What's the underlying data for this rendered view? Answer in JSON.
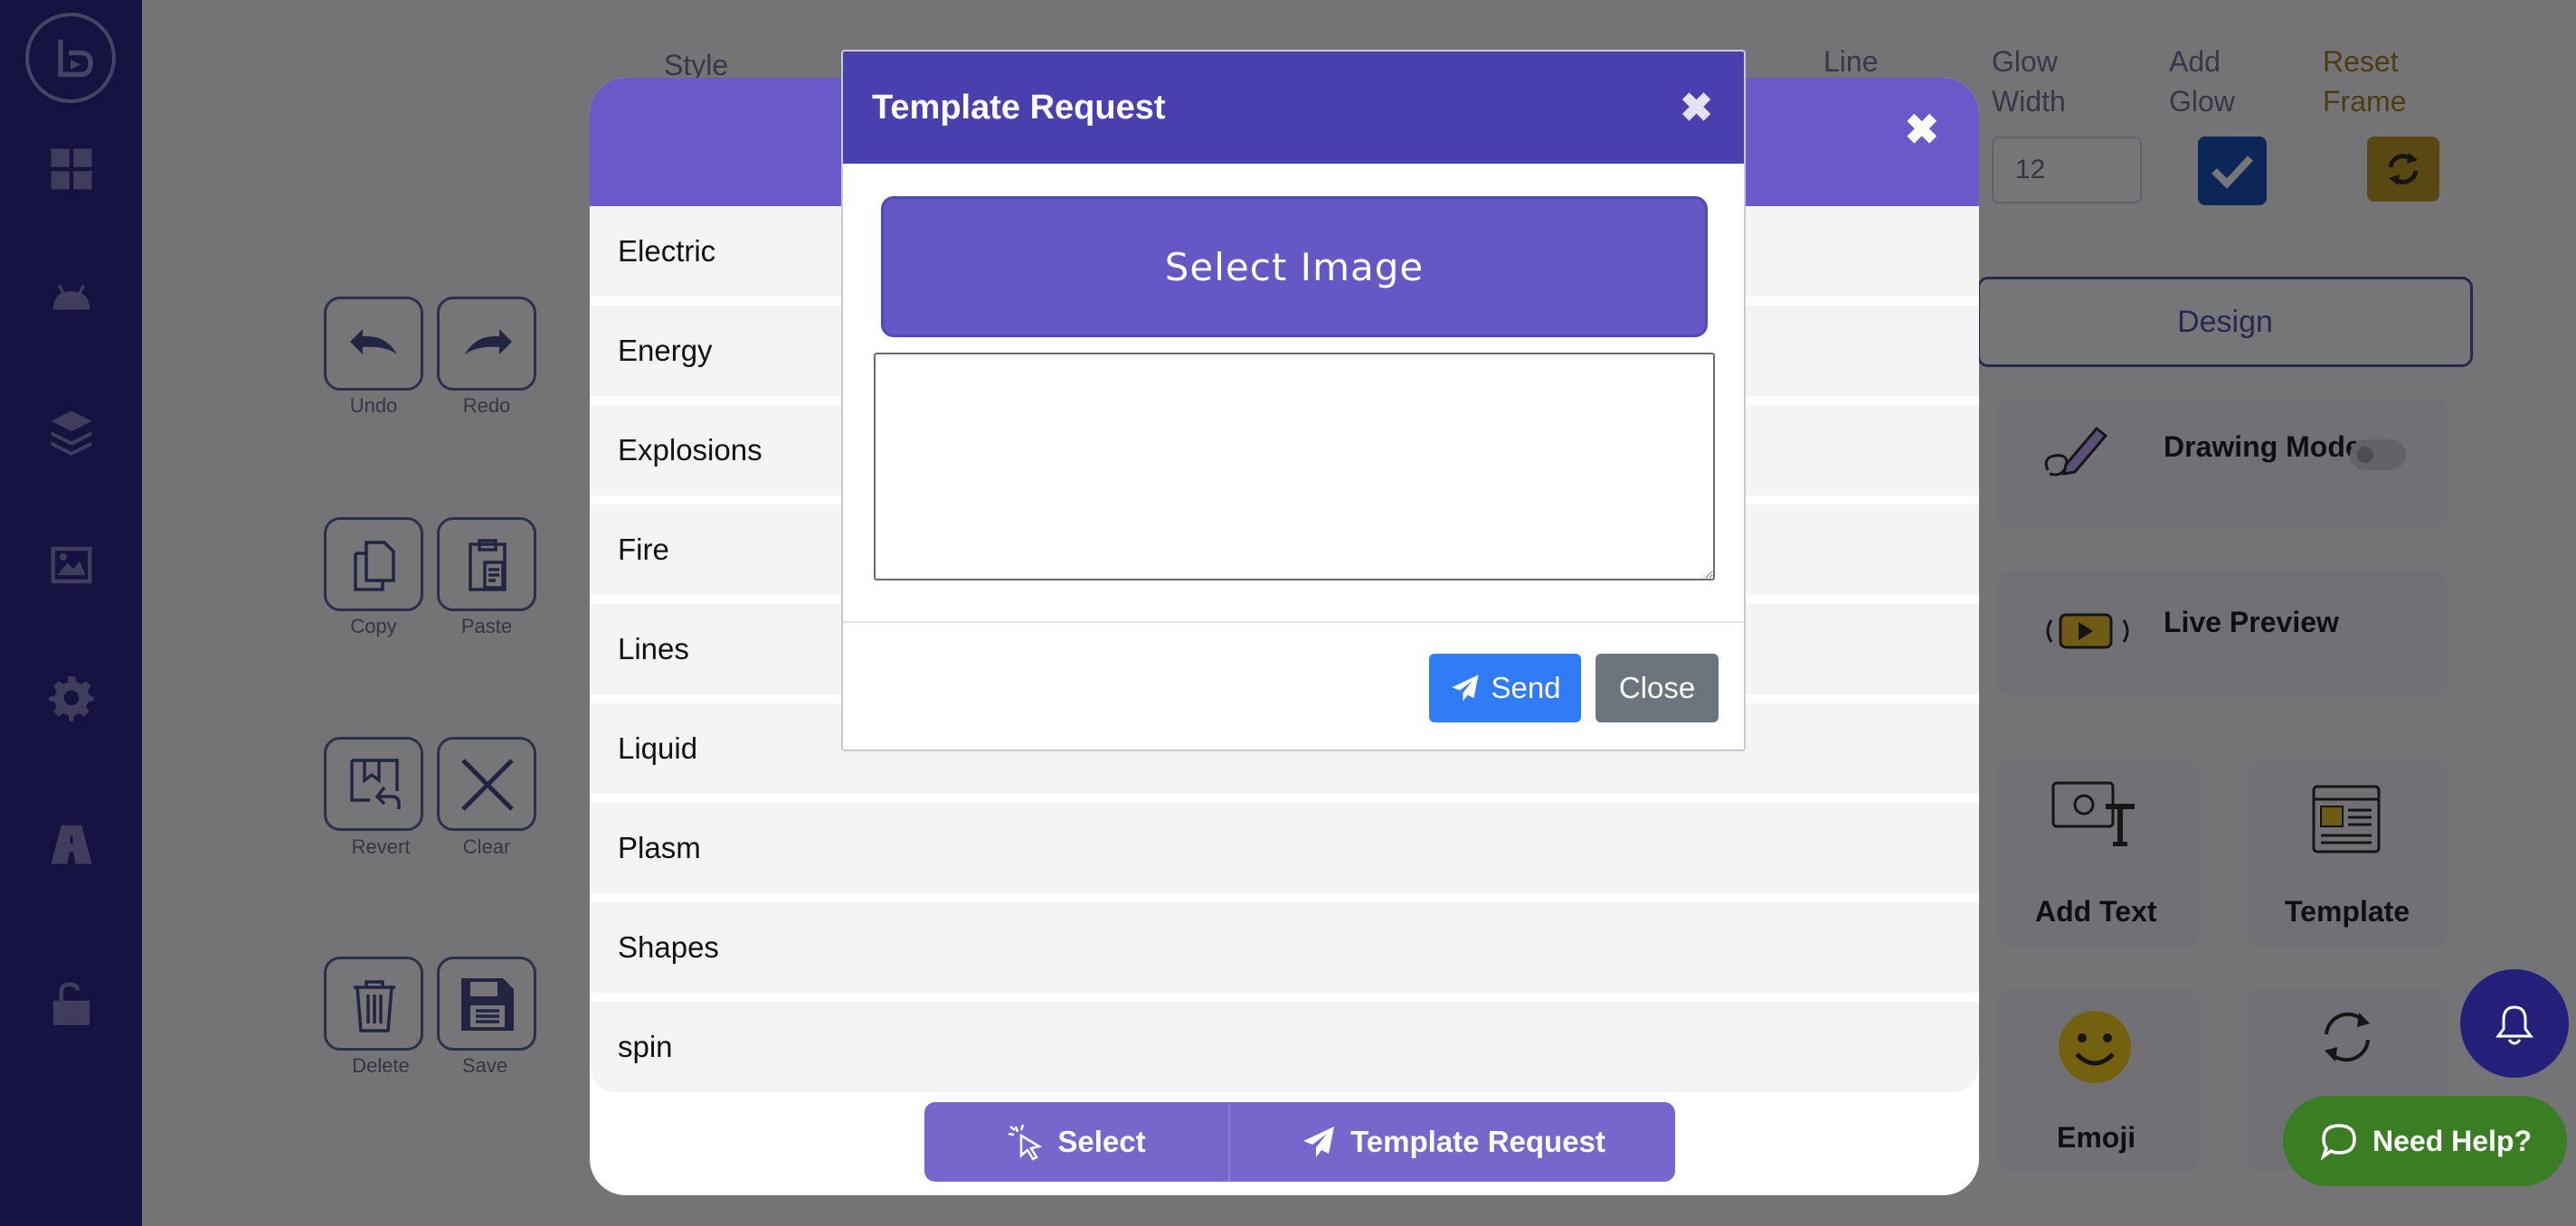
{
  "toolbar": {
    "undo_label": "Undo",
    "redo_label": "Redo",
    "copy_label": "Copy",
    "paste_label": "Paste",
    "revert_label": "Revert",
    "clear_label": "Clear",
    "delete_label": "Delete",
    "save_label": "Save"
  },
  "top_controls": {
    "style_label": "Style",
    "line_label": "Line",
    "glow_width_label_1": "Glow",
    "glow_width_label_2": "Width",
    "glow_width_value": "12",
    "add_glow_label_1": "Add",
    "add_glow_label_2": "Glow",
    "add_glow_checked": true,
    "reset_frame_label_1": "Reset",
    "reset_frame_label_2": "Frame"
  },
  "right_panel": {
    "design_tab": "Design",
    "drawing_mode": "Drawing Mode",
    "live_preview": "Live Preview",
    "add_text": "Add Text",
    "template": "Template",
    "emoji": "Emoji"
  },
  "help_button": "Need Help?",
  "template_modal": {
    "categories": [
      "Electric",
      "Energy",
      "Explosions",
      "Fire",
      "Lines",
      "Liquid",
      "Plasm",
      "Shapes",
      "spin"
    ],
    "select_label": "Select",
    "request_label": "Template Request"
  },
  "request_dialog": {
    "title": "Template Request",
    "select_image_label": "Select Image",
    "textarea_value": "",
    "send_label": "Send",
    "close_label": "Close"
  },
  "colors": {
    "sidebar": "#2c247f",
    "modal_header": "#6a59c8",
    "dialog_header": "#4a3fae",
    "send": "#2f7cf6",
    "close": "#6c757d",
    "help": "#3b7d23"
  }
}
